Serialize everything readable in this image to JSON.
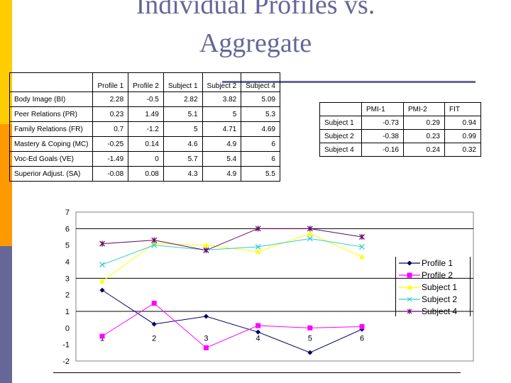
{
  "slide": {
    "title_line1": "Individual Profiles vs.",
    "title_line2": "Aggregate",
    "accent_colors": {
      "yellow": "#ffcc00",
      "orange": "#ff9900",
      "purple": "#666699"
    }
  },
  "profile_table": {
    "headers": [
      "",
      "Profile 1",
      "Profile 2",
      "Subject 1",
      "Subject 2",
      "Subject 4"
    ],
    "rows": [
      {
        "label": "Body Image (BI)",
        "values": [
          "2.28",
          "-0.5",
          "2.82",
          "3.82",
          "5.09"
        ]
      },
      {
        "label": "Peer Relations (PR)",
        "values": [
          "0.23",
          "1.49",
          "5.1",
          "5",
          "5.3"
        ]
      },
      {
        "label": "Family Relations (FR)",
        "values": [
          "0.7",
          "-1.2",
          "5",
          "4.71",
          "4.69"
        ]
      },
      {
        "label": "Mastery & Coping (MC)",
        "values": [
          "-0.25",
          "0.14",
          "4.6",
          "4.9",
          "6"
        ]
      },
      {
        "label": "Voc-Ed Goals (VE)",
        "values": [
          "-1.49",
          "0",
          "5.7",
          "5.4",
          "6"
        ]
      },
      {
        "label": "Superior Adjust. (SA)",
        "values": [
          "-0.08",
          "0.08",
          "4.3",
          "4.9",
          "5.5"
        ]
      }
    ]
  },
  "pmi_table": {
    "headers": [
      "",
      "PMI-1",
      "PMI-2",
      "FIT"
    ],
    "rows": [
      {
        "label": "Subject 1",
        "values": [
          "-0.73",
          "0.29",
          "0.94"
        ]
      },
      {
        "label": "Subject 2",
        "values": [
          "-0.38",
          "0.23",
          "0.99"
        ]
      },
      {
        "label": "Subject 4",
        "values": [
          "-0.16",
          "0.24",
          "0.32"
        ]
      }
    ]
  },
  "chart_data": {
    "type": "line",
    "title": "",
    "xlabel": "",
    "ylabel": "",
    "x": [
      1,
      2,
      3,
      4,
      5,
      6
    ],
    "x_tick_labels": [
      "1",
      "2",
      "3",
      "4",
      "5",
      "6"
    ],
    "ylim": [
      -2,
      7
    ],
    "y_ticks": [
      -2,
      -1,
      0,
      1,
      2,
      3,
      4,
      5,
      6,
      7
    ],
    "gridlines_at": [
      6,
      3,
      1
    ],
    "legend_position": "right",
    "series": [
      {
        "name": "Profile 1",
        "color": "#000066",
        "marker": "diamond",
        "values": [
          2.28,
          0.23,
          0.7,
          -0.25,
          -1.49,
          -0.08
        ]
      },
      {
        "name": "Profile 2",
        "color": "#ff00ff",
        "marker": "square",
        "values": [
          -0.5,
          1.49,
          -1.2,
          0.14,
          0,
          0.08
        ]
      },
      {
        "name": "Subject 1",
        "color": "#ffff00",
        "marker": "triangle",
        "values": [
          2.82,
          5.1,
          5,
          4.6,
          5.7,
          4.3
        ]
      },
      {
        "name": "Subject 2",
        "color": "#33cccc",
        "marker": "x",
        "values": [
          3.82,
          5,
          4.71,
          4.9,
          5.4,
          4.9
        ]
      },
      {
        "name": "Subject 4",
        "color": "#660066",
        "marker": "star",
        "values": [
          5.09,
          5.3,
          4.69,
          6,
          6,
          5.5
        ]
      }
    ]
  }
}
